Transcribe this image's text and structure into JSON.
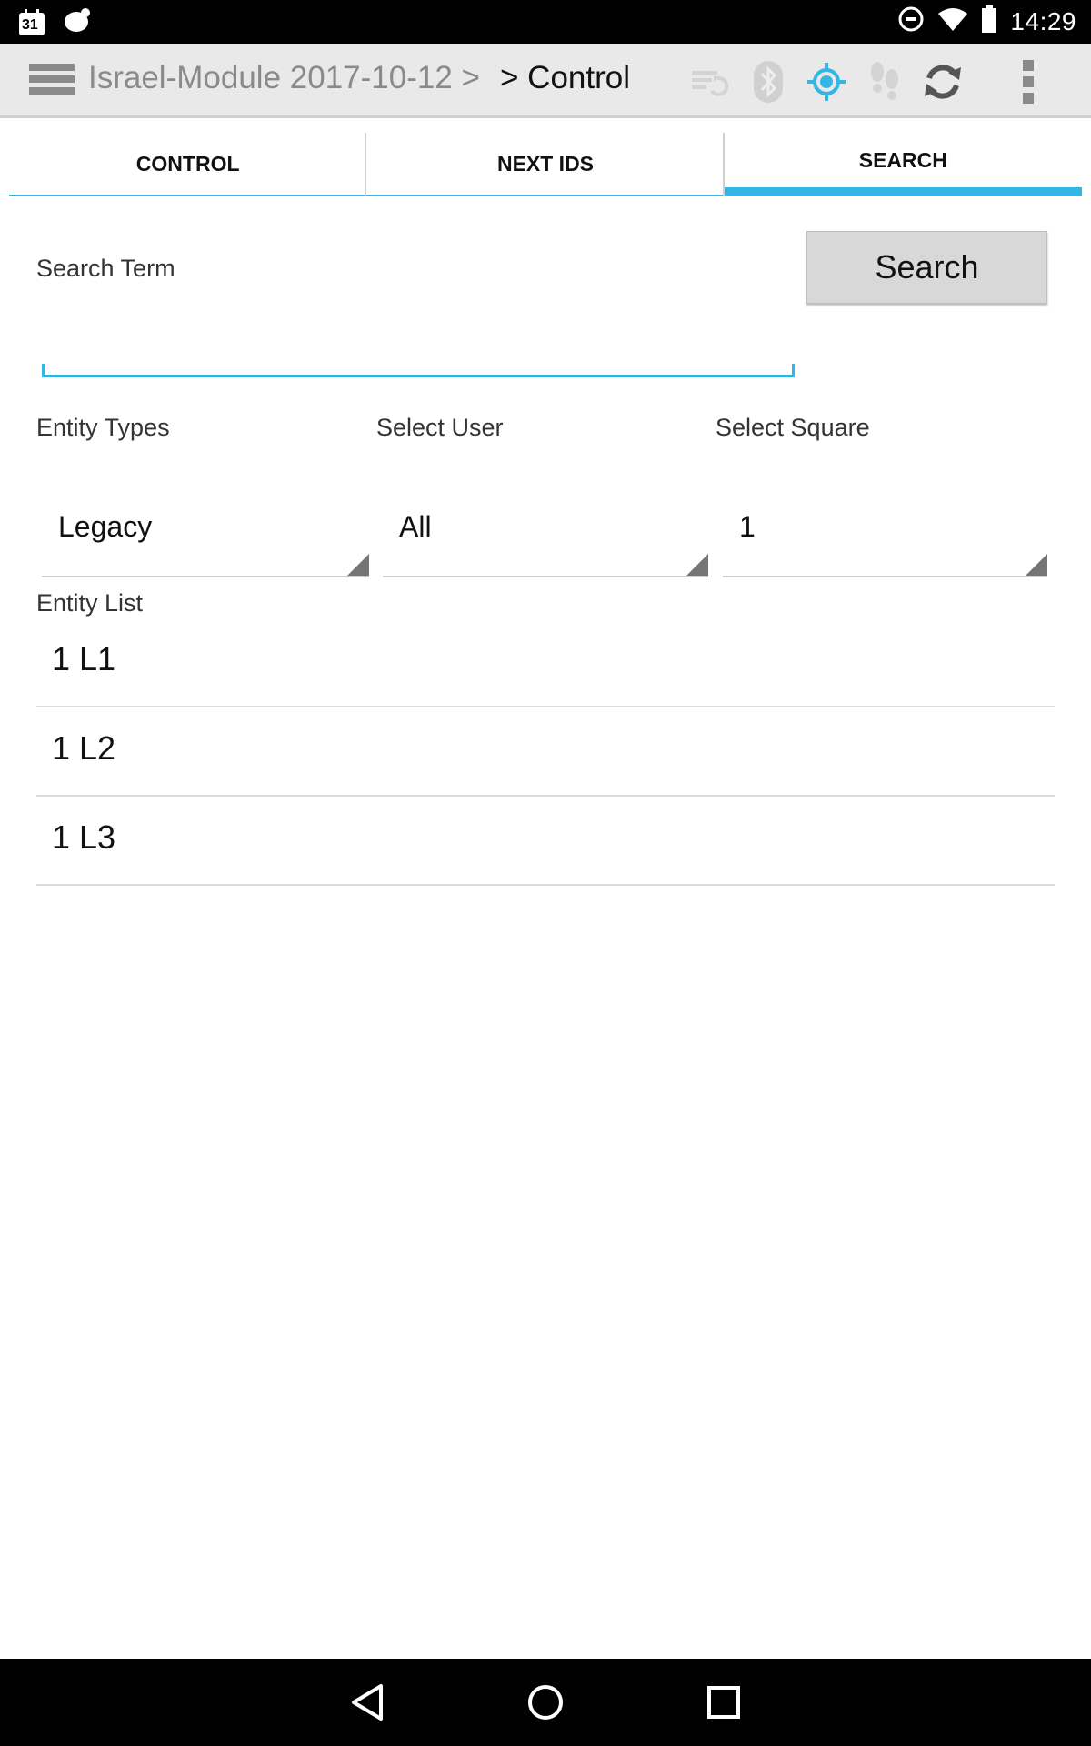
{
  "status_bar": {
    "time": "14:29",
    "calendar_day": "31",
    "left_icons": [
      "calendar-icon",
      "notification-app-icon"
    ],
    "right_icons": [
      "do-not-disturb-icon",
      "wifi-icon",
      "battery-icon"
    ]
  },
  "action_bar": {
    "breadcrumb": "Israel-Module 2017-10-12 >",
    "title": "> Control",
    "icons": [
      "sync-list-icon",
      "bluetooth-icon",
      "gps-location-icon",
      "footsteps-icon",
      "refresh-icon",
      "overflow-menu-icon"
    ],
    "accent": "#33b5e5"
  },
  "tabs": [
    {
      "label": "CONTROL",
      "active": false
    },
    {
      "label": "NEXT IDS",
      "active": false
    },
    {
      "label": "SEARCH",
      "active": true
    }
  ],
  "search": {
    "term_label": "Search Term",
    "term_value": "",
    "button_label": "Search"
  },
  "filters": {
    "entity_types": {
      "label": "Entity Types",
      "value": "Legacy"
    },
    "select_user": {
      "label": "Select User",
      "value": "All"
    },
    "select_square": {
      "label": "Select Square",
      "value": "1"
    }
  },
  "entity_list": {
    "label": "Entity List",
    "items": [
      "1 L1",
      "1 L2",
      "1 L3"
    ]
  },
  "nav_bar": {
    "icons": [
      "back-icon",
      "home-icon",
      "recents-icon"
    ]
  }
}
